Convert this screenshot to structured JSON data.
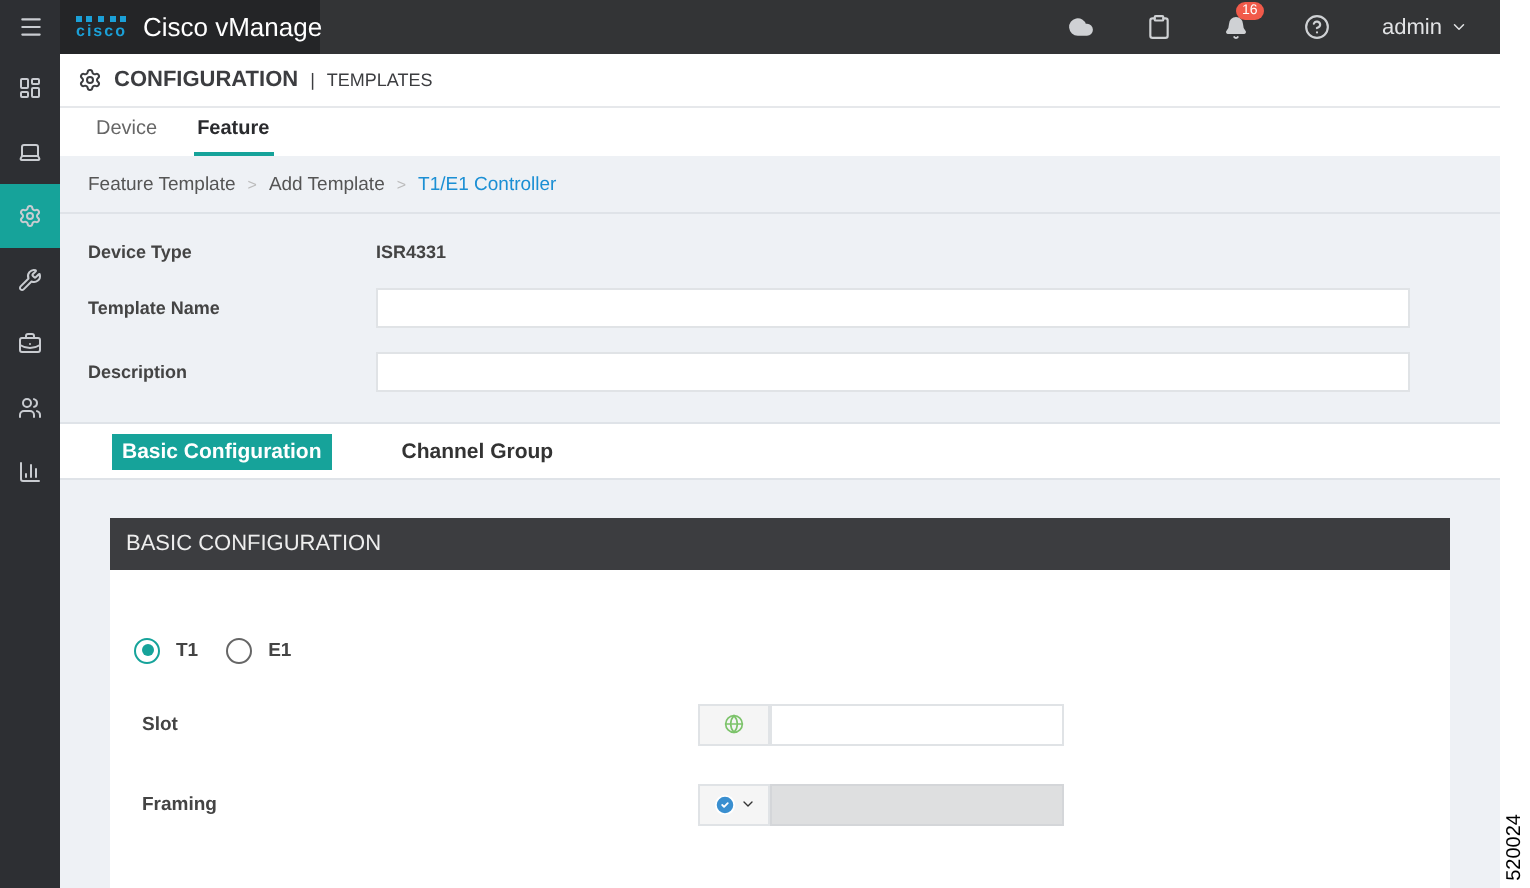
{
  "app": {
    "logo_text": "cisco",
    "title": "Cisco vManage"
  },
  "top_bar": {
    "notification_count": "16",
    "user": "admin"
  },
  "sidebar": {
    "items": [
      {
        "kind": "dashboard",
        "selected": false
      },
      {
        "kind": "monitor",
        "selected": false
      },
      {
        "kind": "configuration",
        "selected": true
      },
      {
        "kind": "tools",
        "selected": false
      },
      {
        "kind": "maintenance",
        "selected": false
      },
      {
        "kind": "administration",
        "selected": false
      },
      {
        "kind": "analytics",
        "selected": false
      }
    ]
  },
  "page_header": {
    "title": "CONFIGURATION",
    "separator": "|",
    "subtitle": "TEMPLATES"
  },
  "tabs": [
    {
      "label": "Device",
      "selected": false
    },
    {
      "label": "Feature",
      "selected": true
    }
  ],
  "breadcrumb": {
    "separator": ">",
    "items": [
      {
        "label": "Feature Template",
        "current": false
      },
      {
        "label": "Add Template",
        "current": false
      },
      {
        "label": "T1/E1 Controller",
        "current": true
      }
    ]
  },
  "form": {
    "device_type": {
      "label": "Device Type",
      "value": "ISR4331"
    },
    "fields": [
      {
        "label": "Template Name"
      },
      {
        "label": "Description"
      }
    ]
  },
  "section_tabs": [
    {
      "label": "Basic Configuration",
      "selected": true
    },
    {
      "label": "Channel Group",
      "selected": false
    }
  ],
  "panel": {
    "title": "BASIC CONFIGURATION",
    "radios": [
      {
        "label": "T1",
        "selected": true
      },
      {
        "label": "E1",
        "selected": false
      }
    ],
    "fields": [
      {
        "label": "Slot",
        "kind": "global",
        "disabled": false
      },
      {
        "label": "Framing",
        "kind": "default",
        "disabled": true
      }
    ]
  },
  "figure_id": "520024"
}
